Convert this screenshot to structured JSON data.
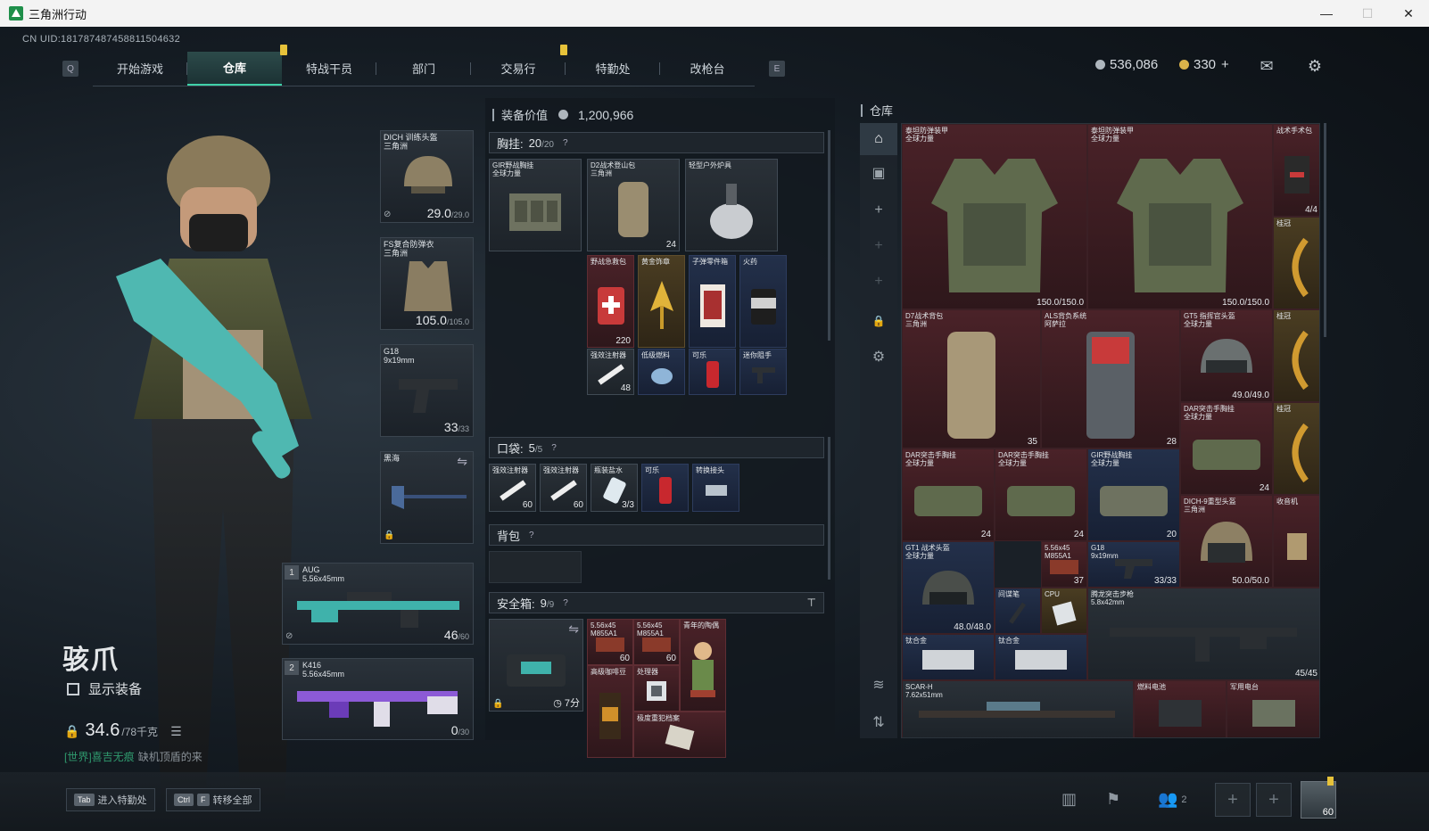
{
  "window": {
    "title": "三角洲行动",
    "minimize": "—",
    "maximize": "☐",
    "close": "✕"
  },
  "uid": "CN UID:18178748745881150463​2",
  "nav": {
    "key_left": "Q",
    "key_right": "E",
    "tabs": [
      "开始游戏",
      "仓库",
      "特战干员",
      "部门",
      "交易行",
      "特勤处",
      "改枪台"
    ],
    "active": "仓库"
  },
  "currency": {
    "silver": "536,086",
    "gold": "330",
    "gold_plus": "+"
  },
  "icons": {
    "mail": "mail-icon",
    "settings": "gear-icon"
  },
  "character": {
    "name": "骇爪",
    "show_equipment_label": "显示装备",
    "weight": "34.6",
    "weight_unit": "/78千克",
    "chat_channel": "[世界]",
    "chat_user": "喜吉无痕",
    "chat_text": "缺机顶盾的来"
  },
  "slots": {
    "helmet": {
      "name": "DICH 训练头盔",
      "sub": "三角洲",
      "val": "29.0",
      "max": "/29.0"
    },
    "armor": {
      "name": "FS复合防弹衣",
      "sub": "三角洲",
      "val": "105.0",
      "max": "/105.0"
    },
    "pistol": {
      "name": "G18",
      "sub": "9x19mm",
      "val": "33",
      "max": "/33"
    },
    "melee": {
      "name": "黑海"
    },
    "primary1": {
      "num": "1",
      "name": "AUG",
      "sub": "5.56x45mm",
      "val": "46",
      "max": "/60"
    },
    "primary2": {
      "num": "2",
      "name": "K416",
      "sub": "5.56x45mm",
      "val": "0",
      "max": "/30"
    }
  },
  "mid": {
    "equip_value_label": "装备价值",
    "equip_value": "1,200,966",
    "chest_label": "胸挂:",
    "chest_count": "20",
    "chest_max": "/20",
    "pocket_label": "口袋:",
    "pocket_count": "5",
    "pocket_max": "/5",
    "backpack_label": "背包",
    "safebox_label": "安全箱:",
    "safebox_count": "9",
    "safebox_max": "/9",
    "safebox_timer": "7分",
    "q": "?",
    "chest_items": [
      {
        "name": "GIR野战胸挂",
        "sub": "全球力量",
        "qty": ""
      },
      {
        "name": "D2战术登山包",
        "sub": "三角洲",
        "qty": "24"
      },
      {
        "name": "轻型户外炉具",
        "sub": "",
        "qty": ""
      },
      {
        "name": "野战急救包",
        "sub": "",
        "qty": "220"
      },
      {
        "name": "黄金饰章",
        "sub": "",
        "qty": ""
      },
      {
        "name": "子弹零件箱",
        "sub": "",
        "qty": ""
      },
      {
        "name": "火药",
        "sub": "",
        "qty": ""
      },
      {
        "name": "强效注射器",
        "sub": "",
        "qty": "48"
      },
      {
        "name": "低级燃料",
        "sub": "",
        "qty": ""
      },
      {
        "name": "可乐",
        "sub": "",
        "qty": ""
      },
      {
        "name": "迷你阻手",
        "sub": "",
        "qty": ""
      }
    ],
    "pocket_items": [
      {
        "name": "强效注射器",
        "qty": "60"
      },
      {
        "name": "强效注射器",
        "qty": "60"
      },
      {
        "name": "瓶装盐水",
        "qty": "3/3"
      },
      {
        "name": "可乐",
        "qty": ""
      },
      {
        "name": "转换接头",
        "qty": ""
      }
    ],
    "safe_items": [
      {
        "name": "5.56x45 M855A1",
        "qty": "60"
      },
      {
        "name": "5.56x45 M855A1",
        "qty": "60"
      },
      {
        "name": "青年的陶偶",
        "qty": ""
      },
      {
        "name": "高级咖啡豆",
        "qty": ""
      },
      {
        "name": "处理器",
        "qty": ""
      },
      {
        "name": "极度重犯档案",
        "qty": ""
      }
    ]
  },
  "warehouse": {
    "title": "仓库",
    "items": [
      {
        "name": "泰坦防弹装甲",
        "sub": "全球力量",
        "qty": "150.0/150.0"
      },
      {
        "name": "泰坦防弹装甲",
        "sub": "全球力量",
        "qty": "150.0/150.0"
      },
      {
        "name": "战术手术包",
        "sub": "",
        "qty": "4/4"
      },
      {
        "name": "桂冠",
        "sub": "",
        "qty": ""
      },
      {
        "name": "D7战术背包",
        "sub": "三角洲",
        "qty": "35"
      },
      {
        "name": "ALS背负系统",
        "sub": "阿萨拉",
        "qty": "28"
      },
      {
        "name": "GT5 指挥官头盔",
        "sub": "全球力量",
        "qty": "49.0/49.0"
      },
      {
        "name": "桂冠",
        "sub": "",
        "qty": ""
      },
      {
        "name": "DAR突击手胸挂",
        "sub": "全球力量",
        "qty": "24"
      },
      {
        "name": "桂冠",
        "sub": "",
        "qty": ""
      },
      {
        "name": "DAR突击手胸挂",
        "sub": "全球力量",
        "qty": "24"
      },
      {
        "name": "DAR突击手胸挂",
        "sub": "全球力量",
        "qty": "24"
      },
      {
        "name": "GIR野战胸挂",
        "sub": "全球力量",
        "qty": "20"
      },
      {
        "name": "DICH-9重型头盔",
        "sub": "三角洲",
        "qty": "50.0/50.0"
      },
      {
        "name": "收音机",
        "sub": "",
        "qty": ""
      },
      {
        "name": "GT1 战术头盔",
        "sub": "全球力量",
        "qty": "48.0/48.0"
      },
      {
        "name": "5.56x45 M855A1",
        "sub": "",
        "qty": "37"
      },
      {
        "name": "G18",
        "sub": "9x19mm",
        "qty": "33/33"
      },
      {
        "name": "间谍笔",
        "sub": "",
        "qty": ""
      },
      {
        "name": "CPU",
        "sub": "",
        "qty": ""
      },
      {
        "name": "腾龙突击步枪",
        "sub": "5.8x42mm",
        "qty": "45/45"
      },
      {
        "name": "钛合金",
        "sub": "",
        "qty": ""
      },
      {
        "name": "钛合金",
        "sub": "",
        "qty": ""
      },
      {
        "name": "SCAR-H",
        "sub": "7.62x51mm",
        "qty": ""
      },
      {
        "name": "燃料电池",
        "sub": "",
        "qty": ""
      },
      {
        "name": "军用电台",
        "sub": "",
        "qty": ""
      }
    ]
  },
  "bottom": {
    "tab_key": "Tab",
    "tab_hint": "进入特勤处",
    "ctrl_key": "Ctrl",
    "f_key": "F",
    "ctrl_hint": "转移全部",
    "party_count": "2",
    "level": "60"
  }
}
